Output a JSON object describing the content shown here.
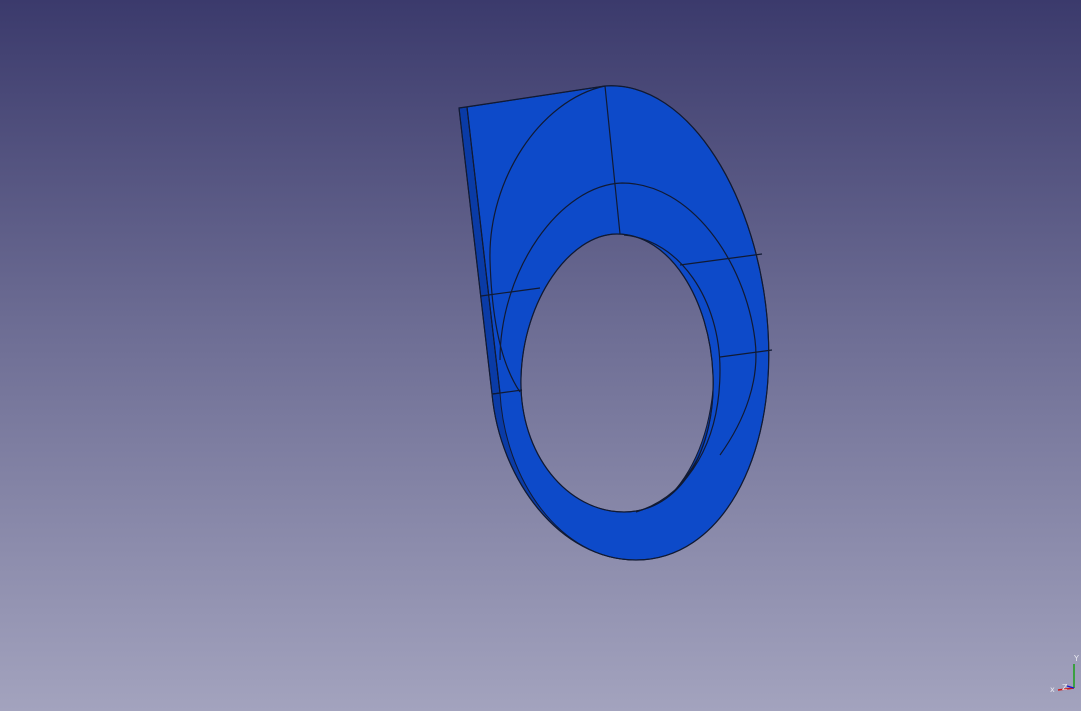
{
  "viewport": {
    "background_top": "#3b3a6c",
    "background_bottom": "#a3a3be"
  },
  "model": {
    "face_color": "#0d4ac9",
    "side_color": "#0a3ba6",
    "edge_color": "#111a33"
  },
  "axis_cross": {
    "x_label": "x",
    "y_label": "Y",
    "z_label": "Z",
    "x_color": "#d01818",
    "y_color": "#18a018",
    "z_color": "#1818d0"
  }
}
